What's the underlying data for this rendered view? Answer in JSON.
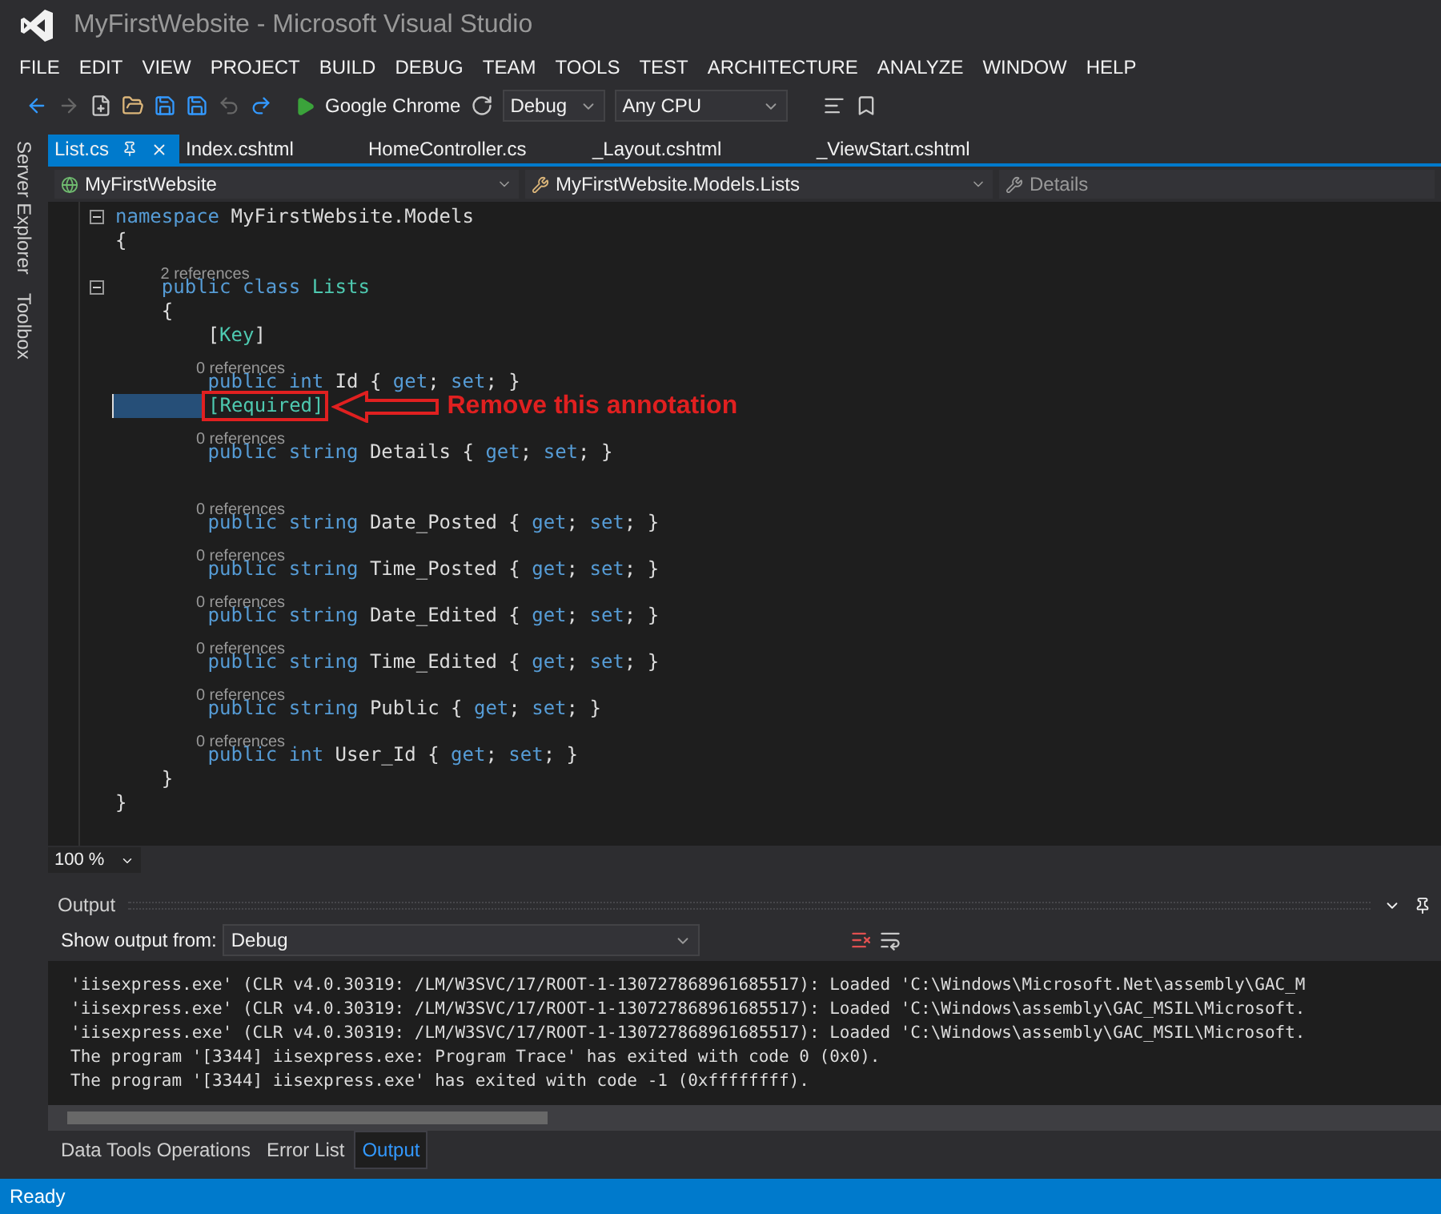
{
  "window": {
    "title": "MyFirstWebsite - Microsoft Visual Studio"
  },
  "menu": [
    "FILE",
    "EDIT",
    "VIEW",
    "PROJECT",
    "BUILD",
    "DEBUG",
    "TEAM",
    "TOOLS",
    "TEST",
    "ARCHITECTURE",
    "ANALYZE",
    "WINDOW",
    "HELP"
  ],
  "toolbar": {
    "run_target": "Google Chrome",
    "configuration": "Debug",
    "platform": "Any CPU"
  },
  "side_tabs": [
    "Server Explorer",
    "Toolbox"
  ],
  "doc_tabs": [
    {
      "label": "List.cs",
      "selected": true
    },
    {
      "label": "Index.cshtml",
      "selected": false
    },
    {
      "label": "HomeController.cs",
      "selected": false
    },
    {
      "label": "_Layout.cshtml",
      "selected": false
    },
    {
      "label": "_ViewStart.cshtml",
      "selected": false
    }
  ],
  "nav_bar": {
    "project": "MyFirstWebsite",
    "type": "MyFirstWebsite.Models.Lists",
    "member": "Details"
  },
  "code_lines": [
    {
      "kind": "code",
      "fold": true,
      "tokens": [
        {
          "kind": "kw",
          "text": "namespace"
        },
        {
          "kind": "plain",
          "text": " MyFirstWebsite.Models"
        }
      ]
    },
    {
      "kind": "code",
      "fold": false,
      "tokens": [
        {
          "kind": "plain",
          "text": "{"
        }
      ]
    },
    {
      "kind": "refs",
      "text": "        2 references"
    },
    {
      "kind": "code",
      "fold": true,
      "tokens": [
        {
          "kind": "kw",
          "text": "    public class "
        },
        {
          "kind": "type",
          "text": "Lists"
        }
      ]
    },
    {
      "kind": "code",
      "fold": false,
      "tokens": [
        {
          "kind": "plain",
          "text": "    {"
        }
      ]
    },
    {
      "kind": "code",
      "fold": false,
      "tokens": [
        {
          "kind": "plain",
          "text": "        ["
        },
        {
          "kind": "type",
          "text": "Key"
        },
        {
          "kind": "plain",
          "text": "]"
        }
      ]
    },
    {
      "kind": "refs",
      "text": "                0 references"
    },
    {
      "kind": "code",
      "fold": false,
      "tokens": [
        {
          "kind": "kw",
          "text": "        public int"
        },
        {
          "kind": "plain",
          "text": " Id { "
        },
        {
          "kind": "kw",
          "text": "get"
        },
        {
          "kind": "plain",
          "text": "; "
        },
        {
          "kind": "kw",
          "text": "set"
        },
        {
          "kind": "plain",
          "text": "; }"
        }
      ]
    },
    {
      "kind": "code",
      "fold": false,
      "highlighted": true,
      "boxed": true,
      "annotation": "Remove this annotation",
      "tokens": [
        {
          "kind": "type",
          "text": "[Required]"
        }
      ]
    },
    {
      "kind": "refs",
      "text": "                0 references"
    },
    {
      "kind": "code",
      "fold": false,
      "tokens": [
        {
          "kind": "kw",
          "text": "        public string"
        },
        {
          "kind": "plain",
          "text": " Details { "
        },
        {
          "kind": "kw",
          "text": "get"
        },
        {
          "kind": "plain",
          "text": "; "
        },
        {
          "kind": "kw",
          "text": "set"
        },
        {
          "kind": "plain",
          "text": "; }"
        }
      ]
    },
    {
      "kind": "blank"
    },
    {
      "kind": "refs",
      "text": "                0 references"
    },
    {
      "kind": "code",
      "fold": false,
      "tokens": [
        {
          "kind": "kw",
          "text": "        public string"
        },
        {
          "kind": "plain",
          "text": " Date_Posted { "
        },
        {
          "kind": "kw",
          "text": "get"
        },
        {
          "kind": "plain",
          "text": "; "
        },
        {
          "kind": "kw",
          "text": "set"
        },
        {
          "kind": "plain",
          "text": "; }"
        }
      ]
    },
    {
      "kind": "refs",
      "text": "                0 references"
    },
    {
      "kind": "code",
      "fold": false,
      "tokens": [
        {
          "kind": "kw",
          "text": "        public string"
        },
        {
          "kind": "plain",
          "text": " Time_Posted { "
        },
        {
          "kind": "kw",
          "text": "get"
        },
        {
          "kind": "plain",
          "text": "; "
        },
        {
          "kind": "kw",
          "text": "set"
        },
        {
          "kind": "plain",
          "text": "; }"
        }
      ]
    },
    {
      "kind": "refs",
      "text": "                0 references"
    },
    {
      "kind": "code",
      "fold": false,
      "tokens": [
        {
          "kind": "kw",
          "text": "        public string"
        },
        {
          "kind": "plain",
          "text": " Date_Edited { "
        },
        {
          "kind": "kw",
          "text": "get"
        },
        {
          "kind": "plain",
          "text": "; "
        },
        {
          "kind": "kw",
          "text": "set"
        },
        {
          "kind": "plain",
          "text": "; }"
        }
      ]
    },
    {
      "kind": "refs",
      "text": "                0 references"
    },
    {
      "kind": "code",
      "fold": false,
      "tokens": [
        {
          "kind": "kw",
          "text": "        public string"
        },
        {
          "kind": "plain",
          "text": " Time_Edited { "
        },
        {
          "kind": "kw",
          "text": "get"
        },
        {
          "kind": "plain",
          "text": "; "
        },
        {
          "kind": "kw",
          "text": "set"
        },
        {
          "kind": "plain",
          "text": "; }"
        }
      ]
    },
    {
      "kind": "refs",
      "text": "                0 references"
    },
    {
      "kind": "code",
      "fold": false,
      "tokens": [
        {
          "kind": "kw",
          "text": "        public string"
        },
        {
          "kind": "plain",
          "text": " Public { "
        },
        {
          "kind": "kw",
          "text": "get"
        },
        {
          "kind": "plain",
          "text": "; "
        },
        {
          "kind": "kw",
          "text": "set"
        },
        {
          "kind": "plain",
          "text": "; }"
        }
      ]
    },
    {
      "kind": "refs",
      "text": "                0 references"
    },
    {
      "kind": "code",
      "fold": false,
      "tokens": [
        {
          "kind": "kw",
          "text": "        public int"
        },
        {
          "kind": "plain",
          "text": " User_Id { "
        },
        {
          "kind": "kw",
          "text": "get"
        },
        {
          "kind": "plain",
          "text": "; "
        },
        {
          "kind": "kw",
          "text": "set"
        },
        {
          "kind": "plain",
          "text": "; }"
        }
      ]
    },
    {
      "kind": "code",
      "fold": false,
      "tokens": [
        {
          "kind": "plain",
          "text": "    }"
        }
      ]
    },
    {
      "kind": "code",
      "fold": false,
      "tokens": [
        {
          "kind": "plain",
          "text": "}"
        }
      ]
    }
  ],
  "zoom": "100 %",
  "output": {
    "title": "Output",
    "source_label": "Show output from:",
    "source": "Debug",
    "lines": [
      "'iisexpress.exe' (CLR v4.0.30319: /LM/W3SVC/17/ROOT-1-130727868961685517): Loaded 'C:\\Windows\\Microsoft.Net\\assembly\\GAC_M",
      "'iisexpress.exe' (CLR v4.0.30319: /LM/W3SVC/17/ROOT-1-130727868961685517): Loaded 'C:\\Windows\\assembly\\GAC_MSIL\\Microsoft.",
      "'iisexpress.exe' (CLR v4.0.30319: /LM/W3SVC/17/ROOT-1-130727868961685517): Loaded 'C:\\Windows\\assembly\\GAC_MSIL\\Microsoft.",
      "The program '[3344] iisexpress.exe: Program Trace' has exited with code 0 (0x0).",
      "The program '[3344] iisexpress.exe' has exited with code -1 (0xffffffff)."
    ]
  },
  "bottom_tabs": [
    {
      "label": "Data Tools Operations",
      "selected": false
    },
    {
      "label": "Error List",
      "selected": false
    },
    {
      "label": "Output",
      "selected": true
    }
  ],
  "status_bar": "Ready"
}
